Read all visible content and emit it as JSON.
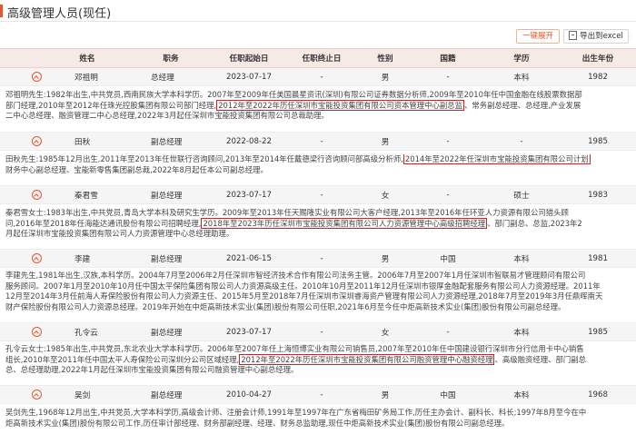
{
  "header": {
    "title": "高级管理人员(现任)"
  },
  "toolbar": {
    "expand_label": "一键展开",
    "export_label": "导出到excel"
  },
  "columns": [
    "姓名",
    "职务",
    "任职起始日",
    "任职终止日",
    "性别",
    "国籍",
    "学历",
    "出生年份"
  ],
  "accent_color": "#e8552b",
  "header_bg": "#f7e9e5",
  "people": [
    {
      "name": "邓祖明",
      "title": "总经理",
      "start": "2023-07-17",
      "end": "-",
      "gender": "男",
      "nationality": "-",
      "education": "本科",
      "birth_year": "1982",
      "bio_lines": [
        [
          {
            "t": "邓祖明先生:1982年出生,中共党员,西南民族大学本科学历。2007年至2009年任美国晨星资讯(深圳)有限公司证券数据分析师,2009年至2010年任中国金融在线股票数据部"
          }
        ],
        [
          {
            "t": "部门经理,2010年至2012年任珠光控股集团有限公司部门经理,"
          },
          {
            "t": "2012年至2022年历任深圳市宝能投资集团有限公司资本管理中心副总监",
            "h": true
          },
          {
            "t": "、常务副总经理、总经理,产业发展"
          }
        ],
        [
          {
            "t": "二中心总经理、融资管理二中心总经理,2022年3月起任深圳市宝能投资集团有限公司总裁助理。"
          }
        ]
      ]
    },
    {
      "name": "田秋",
      "title": "副总经理",
      "start": "2022-08-22",
      "end": "-",
      "gender": "男",
      "nationality": "-",
      "education": "-",
      "birth_year": "1985",
      "bio_lines": [
        [
          {
            "t": "田秋先生:1985年12月出生,2011年至2013年任世联行咨询顾问,2013年至2014年任戴德梁行咨询顾问部高级分析师,"
          },
          {
            "t": "2014年至2022年任深圳市宝能投资集团有限公司计划",
            "h": true
          }
        ],
        [
          {
            "t": "财务中心副总经理、宝能新零售集团副总裁,2022年8月起任本公司副总经理。"
          }
        ]
      ]
    },
    {
      "name": "秦君雪",
      "title": "副总经理",
      "start": "2023-07-17",
      "end": "-",
      "gender": "女",
      "nationality": "-",
      "education": "硕士",
      "birth_year": "1983",
      "bio_lines": [
        [
          {
            "t": "秦君雪女士:1983年出生,中共党员,青岛大学本科及研究生学历。2009年至2013年任天赐隆实业有限公司大客户经理,2013年至2016年任环亚人力资源有限公司猎头顾"
          }
        ],
        [
          {
            "t": "问,2016年至2018年任海能达通讯股份有限公司招聘经理,"
          },
          {
            "t": "2018年至2023年历任深圳市宝能投资集团有限公司人力资源管理中心高级招聘经理",
            "h": true
          },
          {
            "t": "、部门副总、总监,2023年2"
          }
        ],
        [
          {
            "t": "月起任深圳市宝能投资集团有限公司人力资源管理中心总经理助理。"
          }
        ]
      ]
    },
    {
      "name": "李建",
      "title": "副总经理",
      "start": "2021-06-15",
      "end": "-",
      "gender": "男",
      "nationality": "中国",
      "education": "本科",
      "birth_year": "1981",
      "bio_lines": [
        [
          {
            "t": "李建先生,1981年出生,汉族,本科学历。2004年7月至2006年2月任深圳市智经济技术合作有限公司法务主管。2006年7月至2007年1月任深圳市智联易才管理顾问有限公司"
          }
        ],
        [
          {
            "t": "服务顾问。2007年1月至2010年10月任中国太平保险集团有限公司人力资源高级主任。2010年10月至2011年12月任深圳市银厚金融配套服务有限公司人力资源经理。2011年"
          }
        ],
        [
          {
            "t": "12月至2014年3月任前海人寿保险股份有限公司人力资源主任、2015年5月至2018年7月任深圳市深圳睿海资产管理有限公司人力资源经理,2018年7月至2019年3月任鼎晖南天"
          }
        ],
        [
          {
            "t": "财产保险股份有限公司人力资源总经理。2019年开始在中炬高新技术实业(集团)股份有限公司任职,2021年6月至今任中炬高新技术实业(集团)股份有限公司副总经理。"
          }
        ]
      ]
    },
    {
      "name": "孔令云",
      "title": "副总经理",
      "start": "2023-07-17",
      "end": "-",
      "gender": "女",
      "nationality": "-",
      "education": "本科",
      "birth_year": "1985",
      "bio_lines": [
        [
          {
            "t": "孔令云女士:1985年出生,中共党员,东北农业大学本科学历。2006年至2007年任上海恒博实业有限公司销售员,2007年至2010年任中国建设银行深圳市分行信用卡中心销售"
          }
        ],
        [
          {
            "t": "组长,2010年至2011年任中国太平人寿保险公司深圳分公司区域经理,"
          },
          {
            "t": "2012年至2022年历任深圳市宝能投资集团有限公司融资管理中心融资经理",
            "h": true
          },
          {
            "t": "、高级融资经理、部门副总"
          }
        ],
        [
          {
            "t": "总、总经理助理,2022年1月起任深圳市宝能投资集团有限公司融资管理中心副总经理。"
          }
        ]
      ]
    },
    {
      "name": "吴剑",
      "title": "副总经理",
      "start": "2010-04-27",
      "end": "-",
      "gender": "男",
      "nationality": "中国",
      "education": "本科",
      "birth_year": "1968",
      "bio_lines": [
        [
          {
            "t": "吴剑先生,1968年12月出生,中共党员,大学本科学历,高级会计师、注册会计师,1991年至1997年在广东省梅田矿务局工作,历任主办会计、副科长、科长;1997年8月至今在中"
          }
        ],
        [
          {
            "t": "炬高新技术实业(集团)股份有限公司工作,历任审计部经理、财务部副经理、经理、财务总监助理,现任中炬高新技术实业(集团)股份有限公司副总经理。"
          }
        ]
      ]
    }
  ]
}
